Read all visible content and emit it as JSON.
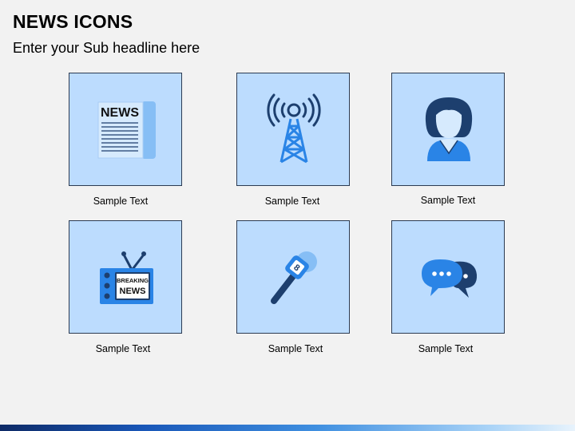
{
  "slide": {
    "title": "NEWS ICONS",
    "subtitle": "Enter your Sub headline here"
  },
  "tiles": [
    {
      "caption": "Sample Text",
      "icon": "newspaper-icon"
    },
    {
      "caption": "Sample Text",
      "icon": "broadcast-tower-icon"
    },
    {
      "caption": "Sample Text",
      "icon": "news-anchor-icon"
    },
    {
      "caption": "Sample Text",
      "icon": "breaking-news-tv-icon"
    },
    {
      "caption": "Sample Text",
      "icon": "microphone-icon"
    },
    {
      "caption": "Sample Text",
      "icon": "chat-bubbles-icon"
    }
  ],
  "icon_text": {
    "newspaper": "NEWS",
    "tv_line1": "BREAKING",
    "tv_line2": "NEWS",
    "mic": "8"
  },
  "colors": {
    "tile_fill": "#bcdcfe",
    "tile_border": "#2c3b52",
    "dark_navy": "#1d3f6e",
    "bright_blue": "#2a84e6",
    "pale_blue": "#86bef5"
  }
}
